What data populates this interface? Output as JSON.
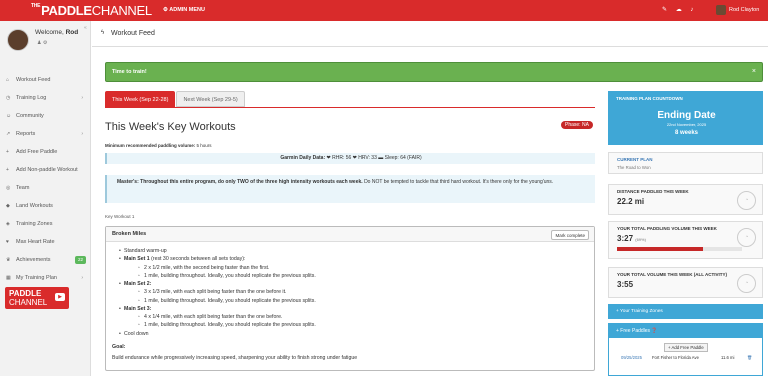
{
  "topbar": {
    "brand_the": "THE",
    "brand_paddle": "PADDLE",
    "brand_channel": "CHANNEL",
    "admin_menu": "⚙ ADMIN MENU",
    "icons": [
      "tools-icon",
      "cloud-icon",
      "bell-icon"
    ],
    "user_name": "Rod Clayton"
  },
  "sidebar": {
    "welcome_prefix": "Welcome,",
    "welcome_name": "Rod",
    "items": [
      {
        "label": "Workout Feed",
        "icon": "home-icon",
        "has_chevron": false
      },
      {
        "label": "Training Log",
        "icon": "clock-icon",
        "has_chevron": true
      },
      {
        "label": "Community",
        "icon": "users-icon",
        "has_chevron": false
      },
      {
        "label": "Reports",
        "icon": "chart-icon",
        "has_chevron": true
      },
      {
        "label": "Add Free Paddle",
        "icon": "plus-icon",
        "has_chevron": false
      },
      {
        "label": "Add Non-paddle Workout",
        "icon": "plus-icon",
        "has_chevron": false
      },
      {
        "label": "Team",
        "icon": "team-icon",
        "has_chevron": false
      },
      {
        "label": "Land Workouts",
        "icon": "dumbbell-icon",
        "has_chevron": false
      },
      {
        "label": "Training Zones",
        "icon": "zones-icon",
        "has_chevron": false
      },
      {
        "label": "Max Heart Rate",
        "icon": "heart-icon",
        "has_chevron": false
      },
      {
        "label": "Achievements",
        "icon": "trophy-icon",
        "has_chevron": false,
        "badge": "22"
      },
      {
        "label": "My Training Plan",
        "icon": "calendar-icon",
        "has_chevron": true
      }
    ],
    "logo_line1": "PADDLE",
    "logo_line2": "CHANNEL"
  },
  "page": {
    "title": "Workout Feed"
  },
  "alert": {
    "text": "Time to train!",
    "close": "×"
  },
  "tabs": [
    {
      "label": "This Week (Sep 22-28)",
      "active": true
    },
    {
      "label": "Next Week (Sep 29-5)",
      "active": false
    }
  ],
  "main": {
    "heading": "This Week's Key Workouts",
    "phase": "Phase: NA",
    "min_label": "Minimum recommended paddling volume:",
    "min_value": "5 hours",
    "garmin_label": "Garmin Daily Data:",
    "garmin_values": "❤ RHR: 56 ❤ HRV: 33 ▬ Sleep: 64 (FAIR)",
    "masters_bold": "Master's: Throughout this entire program, do only TWO of the three high intensity workouts each week.",
    "masters_rest": "Do NOT be tempted to tackle that third hard workout. It's there only for the young'uns.",
    "key_workout_label": "Key Workout 1"
  },
  "workout": {
    "title": "Broken Miles",
    "mark_complete": "Mark complete",
    "lines": [
      {
        "level": 1,
        "bold": "",
        "text": "Standard warm-up"
      },
      {
        "level": 1,
        "bold": "Main Set 1",
        "text": " (rest 30 seconds between all sets today):"
      },
      {
        "level": 2,
        "bold": "",
        "text": "2 x 1/2 mile, with the second being faster than the first."
      },
      {
        "level": 2,
        "bold": "",
        "text": "1 mile, building throughout. Ideally, you should replicate the previous splits."
      },
      {
        "level": 1,
        "bold": "Main Set 2:",
        "text": ""
      },
      {
        "level": 2,
        "bold": "",
        "text": "3 x 1/3 mile, with each split being faster than the one before it."
      },
      {
        "level": 2,
        "bold": "",
        "text": "1 mile, building throughout. Ideally, you should replicate the previous splits."
      },
      {
        "level": 1,
        "bold": "Main Set 3:",
        "text": ""
      },
      {
        "level": 2,
        "bold": "",
        "text": "4 x 1/4 mile, with each split being faster than the one before."
      },
      {
        "level": 2,
        "bold": "",
        "text": "1 mile, building throughout. Ideally, you should replicate the previous splits."
      },
      {
        "level": 1,
        "bold": "",
        "text": "Cool down"
      }
    ],
    "goal_label": "Goal:",
    "goal_text": "Build endurance while progressively increasing speed, sharpening your ability to finish strong under fatigue"
  },
  "right": {
    "countdown_title": "TRAINING PLAN COUNTDOWN",
    "ending_date": "Ending Date",
    "ending_date_sub": "22nd November, 2025",
    "weeks": "8 weeks",
    "current_plan_label": "CURRENT PLAN",
    "current_plan_value": "The Road to Won",
    "distance_label": "DISTANCE PADDLED THIS WEEK",
    "distance_value": "22.2 mi",
    "volume_label": "YOUR TOTAL PADDLING VOLUME THIS WEEK",
    "volume_value": "3:27",
    "volume_pct": "(69%)",
    "volume_fraction": 0.69,
    "total_label": "YOUR TOTAL VOLUME THIS WEEK (ALL ACTIVITY)",
    "total_value": "3:55",
    "zones_label": "+ Your Training Zones",
    "free_label": "+ Free Paddles ❓",
    "add_free": "+ Add Free Paddle",
    "paddle_row": {
      "date": "09/25/2025",
      "name": "Fort Fisher to Florida Ave",
      "miles": "11.6 mi",
      "delete": "🗑"
    }
  }
}
